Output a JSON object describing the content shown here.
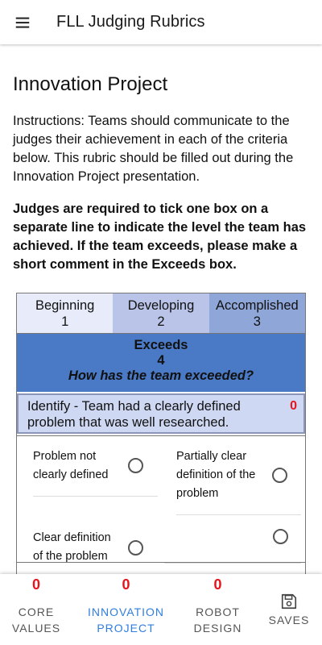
{
  "app": {
    "title": "FLL Judging Rubrics"
  },
  "page": {
    "title": "Innovation Project",
    "instructions": "Instructions: Teams should communicate to the judges their achievement in each of the criteria below. This rubric should be filled out during the Innovation Project presentation.",
    "judges_note": "Judges are required to tick one box on a separate line to indicate the level the team has achieved. If the team exceeds, please make a short comment in the Exceeds box."
  },
  "legend": {
    "beginning": {
      "label": "Beginning",
      "value": "1"
    },
    "developing": {
      "label": "Developing",
      "value": "2"
    },
    "accomplished": {
      "label": "Accomplished",
      "value": "3"
    },
    "exceeds": {
      "label": "Exceeds",
      "value": "4",
      "question": "How has the team exceeded?"
    }
  },
  "criterion": {
    "text": "Identify - Team had a clearly defined problem that was well researched.",
    "score": "0"
  },
  "options": {
    "beginning": "Problem not clearly defined",
    "developing": "Partially clear definition of the problem",
    "accomplished": "Clear definition of the problem",
    "exceeds": ""
  },
  "bottom_nav": [
    {
      "label": "CORE VALUES",
      "count": "0"
    },
    {
      "label": "INNOVATION PROJECT",
      "count": "0"
    },
    {
      "label": "ROBOT DESIGN",
      "count": "0"
    },
    {
      "label": "SAVES",
      "icon": "save-icon"
    }
  ],
  "colors": {
    "accent": "#2f7de0",
    "score_red": "#e8141c",
    "beginning": "#e8ebfa",
    "developing": "#bac4e8",
    "accomplished": "#8fa6d9",
    "exceeds": "#4a7ac6",
    "criterion_bg": "#cfd8f3"
  }
}
